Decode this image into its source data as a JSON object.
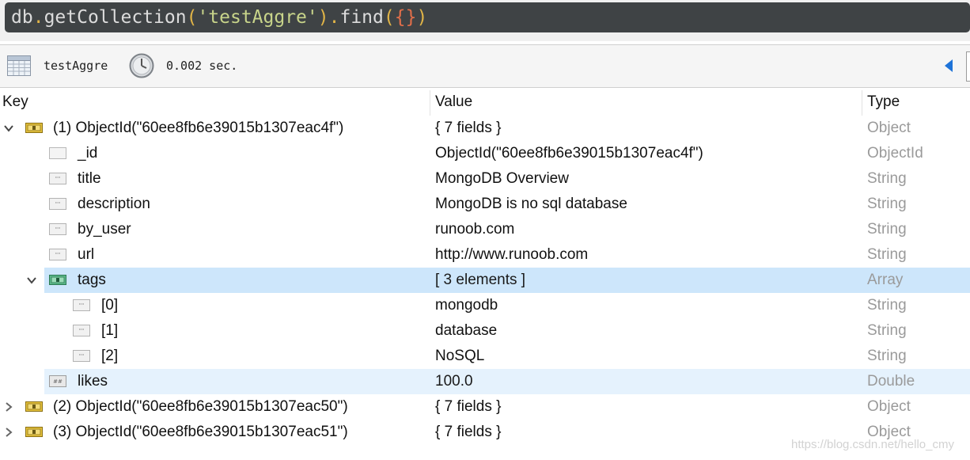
{
  "query": {
    "db": "db",
    "dot1": ".",
    "method1": "getCollection",
    "open1": "(",
    "collection_arg": "'testAggre'",
    "close1": ")",
    "dot2": ".",
    "method2": "find",
    "open2": "(",
    "arg2": "{}",
    "close2": ")"
  },
  "info": {
    "collection": "testAggre",
    "time": "0.002 sec."
  },
  "columns": {
    "key": "Key",
    "value": "Value",
    "type": "Type"
  },
  "rows": [
    {
      "key": "(1) ObjectId(\"60ee8fb6e39015b1307eac4f\")",
      "value": "{ 7 fields }",
      "type": "Object",
      "icon": "object-icon",
      "expanded": true
    },
    {
      "key": "_id",
      "value": "ObjectId(\"60ee8fb6e39015b1307eac4f\")",
      "type": "ObjectId",
      "icon": "objectid-icon"
    },
    {
      "key": "title",
      "value": "MongoDB Overview",
      "type": "String",
      "icon": "string-icon"
    },
    {
      "key": "description",
      "value": "MongoDB is no sql database",
      "type": "String",
      "icon": "string-icon"
    },
    {
      "key": "by_user",
      "value": "runoob.com",
      "type": "String",
      "icon": "string-icon"
    },
    {
      "key": "url",
      "value": "http://www.runoob.com",
      "type": "String",
      "icon": "string-icon"
    },
    {
      "key": "tags",
      "value": "[ 3 elements ]",
      "type": "Array",
      "icon": "array-icon",
      "expanded": true,
      "selected": true
    },
    {
      "key": "[0]",
      "value": "mongodb",
      "type": "String",
      "icon": "string-icon"
    },
    {
      "key": "[1]",
      "value": "database",
      "type": "String",
      "icon": "string-icon"
    },
    {
      "key": "[2]",
      "value": "NoSQL",
      "type": "String",
      "icon": "string-icon"
    },
    {
      "key": "likes",
      "value": "100.0",
      "type": "Double",
      "icon": "double-icon",
      "hovered": true
    },
    {
      "key": "(2) ObjectId(\"60ee8fb6e39015b1307eac50\")",
      "value": "{ 7 fields }",
      "type": "Object",
      "icon": "object-icon",
      "expanded": false
    },
    {
      "key": "(3) ObjectId(\"60ee8fb6e39015b1307eac51\")",
      "value": "{ 7 fields }",
      "type": "Object",
      "icon": "object-icon",
      "expanded": false
    }
  ],
  "watermark": "https://blog.csdn.net/hello_cmy",
  "colors": {
    "query_bg": "#3f4345",
    "selected_row": "#cde6fb",
    "hovered_row": "#e5f2fd",
    "type_text": "#9a9a9a",
    "nav_arrow": "#1e73d8"
  }
}
